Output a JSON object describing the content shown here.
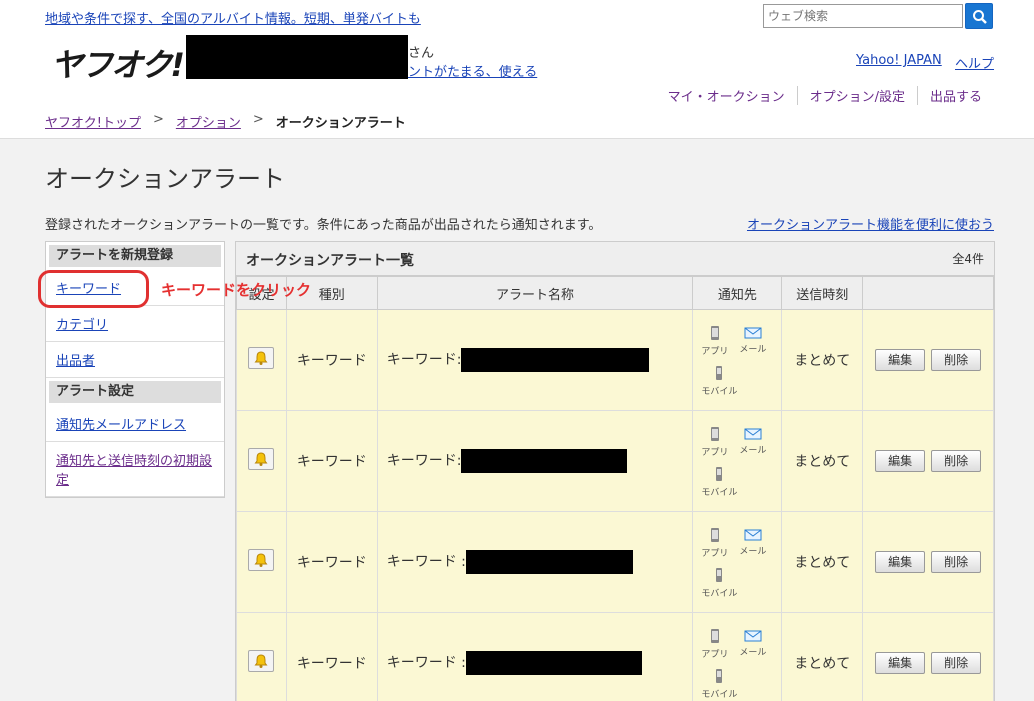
{
  "header": {
    "promo": "地域や条件で探す、全国のアルバイト情報。短期、単発バイトも",
    "search_placeholder": "ウェブ検索",
    "logo": "ヤフオク!",
    "san": "さん",
    "points_link": "ントがたまる、使える",
    "yahoo_japan": "Yahoo! JAPAN",
    "help": "ヘルプ"
  },
  "subnav": [
    "マイ・オークション",
    "オプション/設定",
    "出品する"
  ],
  "breadcrumb": {
    "top": "ヤフオク!トップ",
    "option": "オプション",
    "current": "オークションアラート",
    "sep": ">"
  },
  "page": {
    "title": "オークションアラート",
    "description": "登録されたオークションアラートの一覧です。条件にあった商品が出品されたら通知されます。",
    "help_link": "オークションアラート機能を便利に使おう"
  },
  "sidebar": {
    "section1": "アラートを新規登録",
    "items1": [
      "キーワード",
      "カテゴリ",
      "出品者"
    ],
    "section2": "アラート設定",
    "items2": [
      "通知先メールアドレス",
      "通知先と送信時刻の初期設定"
    ]
  },
  "annotation": "キーワードをクリック",
  "list": {
    "title": "オークションアラート一覧",
    "count": "全4件",
    "columns": [
      "設定",
      "種別",
      "アラート名称",
      "通知先",
      "送信時刻",
      ""
    ],
    "notify_labels": {
      "app": "アプリ",
      "mail": "メール",
      "mobile": "モバイル"
    },
    "rows": [
      {
        "type": "キーワード",
        "name": "キーワード:",
        "send_time": "まとめて",
        "edit": "編集",
        "delete": "削除"
      },
      {
        "type": "キーワード",
        "name": "キーワード:",
        "send_time": "まとめて",
        "edit": "編集",
        "delete": "削除"
      },
      {
        "type": "キーワード",
        "name": "キーワード :",
        "send_time": "まとめて",
        "edit": "編集",
        "delete": "削除"
      },
      {
        "type": "キーワード",
        "name": "キーワード :",
        "send_time": "まとめて",
        "edit": "編集",
        "delete": "削除"
      }
    ]
  },
  "colors": {
    "accent_blue": "#1976d2",
    "highlight_red": "#e03030",
    "row_bg": "#fbf8d4"
  }
}
